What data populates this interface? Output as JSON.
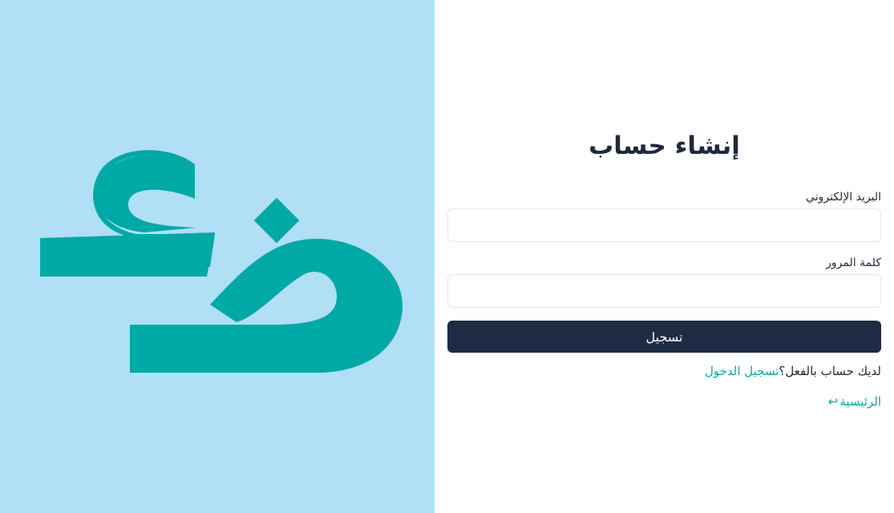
{
  "brand": {
    "logo_icon": "dad-ain-logo",
    "background_color": "#b0dff6",
    "logo_color": "#00a9a6"
  },
  "form": {
    "title": "إنشاء حساب",
    "email_label": "البريد الإلكتروني",
    "email_value": "",
    "password_label": "كلمة المرور",
    "password_value": "",
    "submit_label": "تسجيل",
    "have_account_text": "لديك حساب بالفعل؟",
    "login_link": "تسجيل الدخول",
    "home_link": "الرئيسية",
    "home_icon": "return-arrow-icon"
  },
  "colors": {
    "primary_button": "#1e2b44",
    "link": "#0ea5a0",
    "title": "#1e293b"
  }
}
